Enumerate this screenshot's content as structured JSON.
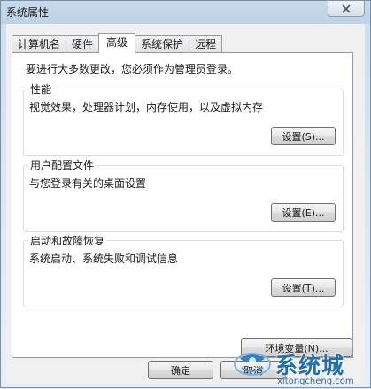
{
  "window": {
    "title": "系统属性"
  },
  "tabs": [
    {
      "label": "计算机名"
    },
    {
      "label": "硬件"
    },
    {
      "label": "高级"
    },
    {
      "label": "系统保护"
    },
    {
      "label": "远程"
    }
  ],
  "active_tab": "高级",
  "intro": "要进行大多数更改，您必须作为管理员登录。",
  "groups": [
    {
      "title": "性能",
      "description": "视觉效果，处理器计划，内存使用，以及虚拟内存",
      "button": "设置(S)..."
    },
    {
      "title": "用户配置文件",
      "description": "与您登录有关的桌面设置",
      "button": "设置(E)..."
    },
    {
      "title": "启动和故障恢复",
      "description": "系统启动、系统失败和调试信息",
      "button": "设置(T)..."
    }
  ],
  "env_button": "环境变量(N)...",
  "footer": {
    "ok": "确定",
    "cancel": "取消"
  },
  "watermark": {
    "brand": "系统城",
    "url": "xitongcheng.com"
  }
}
